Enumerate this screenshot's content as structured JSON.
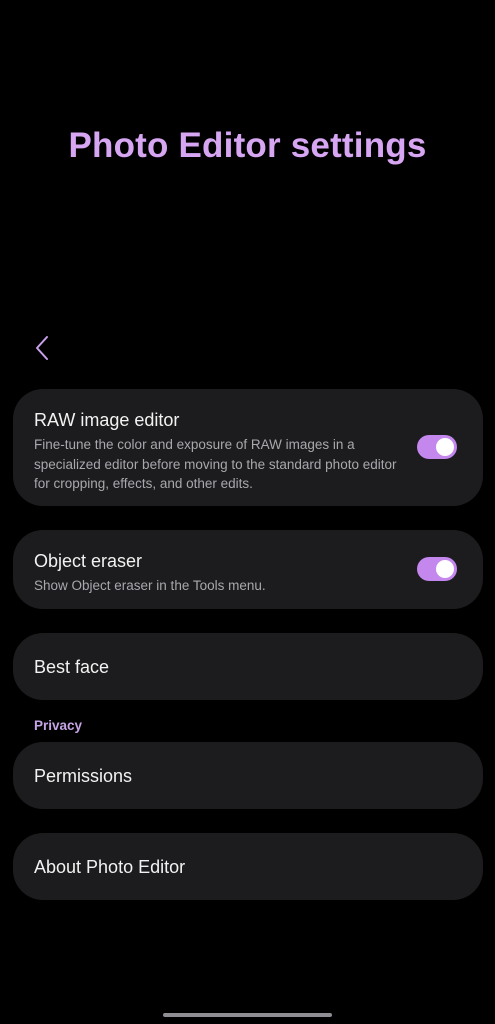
{
  "header": {
    "title": "Photo Editor settings",
    "back_icon": "chevron-left-icon"
  },
  "colors": {
    "accent": "#c387ee",
    "title": "#d7a6f3",
    "card_background": "#1c1c1e",
    "background": "#000000"
  },
  "settings": {
    "raw_image_editor": {
      "title": "RAW image editor",
      "description": "Fine-tune the color and exposure of RAW images in a specialized editor before moving to the standard photo editor for cropping, effects, and other edits.",
      "enabled": true
    },
    "object_eraser": {
      "title": "Object eraser",
      "description": "Show Object eraser in the Tools menu.",
      "enabled": true
    },
    "best_face": {
      "title": "Best face"
    }
  },
  "privacy": {
    "section_label": "Privacy",
    "permissions": {
      "title": "Permissions"
    }
  },
  "about": {
    "title": "About Photo Editor"
  }
}
